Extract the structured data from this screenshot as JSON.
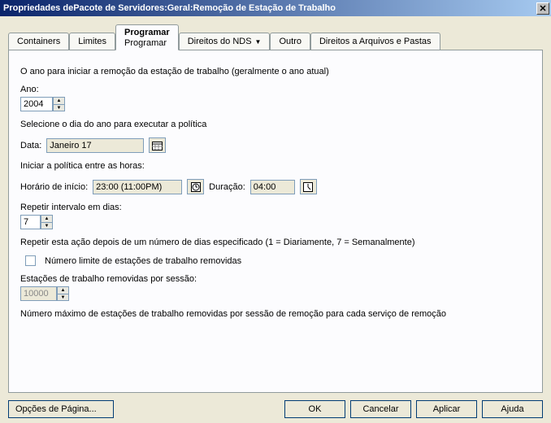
{
  "window": {
    "title": "Propriedades dePacote de Servidores:Geral:Remoção de Estação de Trabalho"
  },
  "tabs": {
    "containers": "Containers",
    "limites": "Limites",
    "programar_label": "Programar",
    "programar_sub": "Programar",
    "direitos_nds": "Direitos do NDS",
    "outro": "Outro",
    "direitos_arq": "Direitos a Arquivos e Pastas"
  },
  "form": {
    "intro": "O ano para iniciar a remoção da estação de trabalho (geralmente o ano atual)",
    "ano_label": "Ano:",
    "ano_value": "2004",
    "dia_intro": "Selecione o dia do ano para executar a política",
    "data_label": "Data:",
    "data_value": "Janeiro 17",
    "iniciar_label": "Iniciar a política entre as horas:",
    "horario_label": "Horário de início:",
    "horario_value": "23:00 (11:00PM)",
    "duracao_label": "Duração:",
    "duracao_value": "04:00",
    "repetir_label": "Repetir intervalo em dias:",
    "repetir_value": "7",
    "repetir_desc": "Repetir esta ação depois de um número de dias especificado (1 = Diariamente, 7 = Semanalmente)",
    "limite_check": "Número limite de estações de trabalho removidas",
    "sessao_label": "Estações de trabalho removidas por sessão:",
    "sessao_value": "10000",
    "max_desc": "Número máximo de estações de trabalho removidas por sessão de remoção para cada serviço de remoção"
  },
  "footer": {
    "page_options": "Opções de Página...",
    "ok": "OK",
    "cancel": "Cancelar",
    "apply": "Aplicar",
    "help": "Ajuda"
  }
}
